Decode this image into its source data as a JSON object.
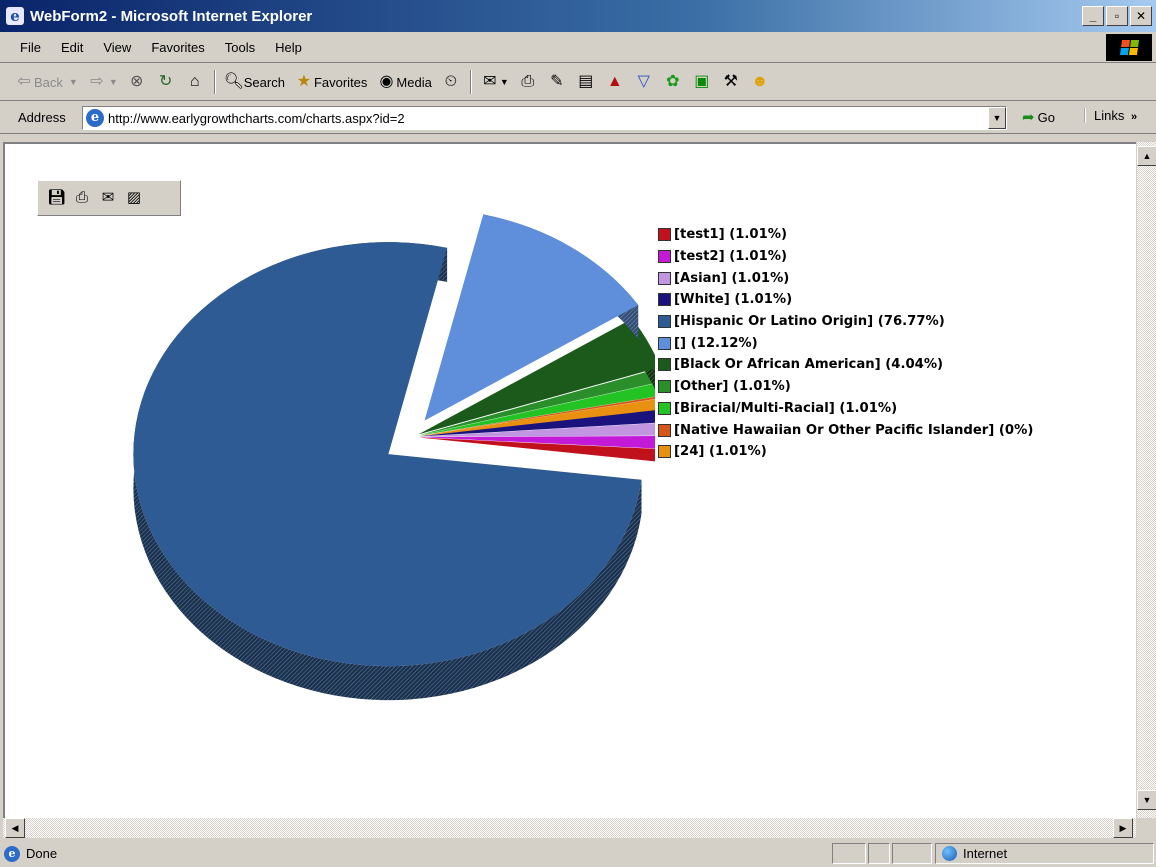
{
  "window": {
    "title": "WebForm2 - Microsoft Internet Explorer",
    "min": "_",
    "max": "▫",
    "close": "✕"
  },
  "menu": [
    "File",
    "Edit",
    "View",
    "Favorites",
    "Tools",
    "Help"
  ],
  "toolbar": {
    "back": "Back",
    "search": "Search",
    "favorites": "Favorites",
    "media": "Media"
  },
  "address": {
    "label": "Address",
    "url": "http://www.earlygrowthcharts.com/charts.aspx?id=2",
    "go": "Go",
    "links": "Links"
  },
  "chart_data": {
    "type": "pie",
    "style": "3d exploded",
    "legend_position": "right",
    "slices": [
      {
        "label": "[test1] (1.01%)",
        "value": 1.01,
        "color": "#c1111c"
      },
      {
        "label": "[test2] (1.01%)",
        "value": 1.01,
        "color": "#c21ad6"
      },
      {
        "label": "[Asian] (1.01%)",
        "value": 1.01,
        "color": "#c295e0"
      },
      {
        "label": "[White] (1.01%)",
        "value": 1.01,
        "color": "#1a137e"
      },
      {
        "label": "[Hispanic Or Latino Origin] (76.77%)",
        "value": 76.77,
        "color": "#2e5b94"
      },
      {
        "label": "[] (12.12%)",
        "value": 12.12,
        "color": "#5f8fdb"
      },
      {
        "label": "[Black Or African American] (4.04%)",
        "value": 4.04,
        "color": "#1c5a1c"
      },
      {
        "label": "[Other] (1.01%)",
        "value": 1.01,
        "color": "#2a8f2a"
      },
      {
        "label": "[Biracial/Multi-Racial] (1.01%)",
        "value": 1.01,
        "color": "#22c322"
      },
      {
        "label": "[Native Hawaiian Or Other Pacific Islander] (0%)",
        "value": 0,
        "color": "#d4561a"
      },
      {
        "label": "[24] (1.01%)",
        "value": 1.01,
        "color": "#e8900f"
      }
    ]
  },
  "status": {
    "text": "Done",
    "zone": "Internet"
  }
}
